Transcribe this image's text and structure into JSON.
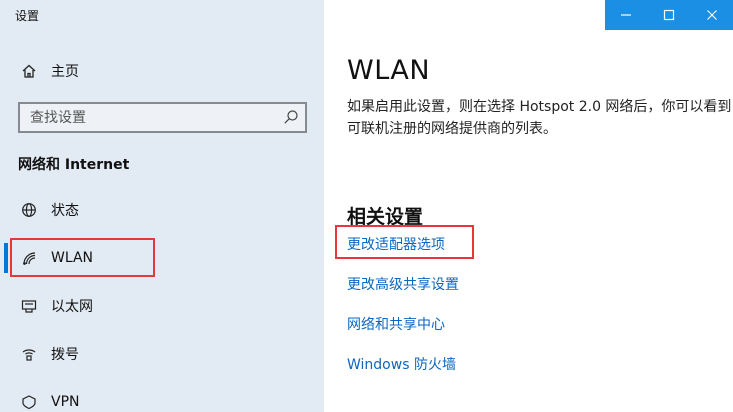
{
  "window": {
    "title": "设置",
    "controls": [
      "minimize-icon",
      "maximize-icon",
      "close-icon"
    ],
    "accent_color": "#1a8fe3"
  },
  "sidebar": {
    "home_label": "主页",
    "search_placeholder": "查找设置",
    "section_header": "网络和 Internet",
    "items": [
      {
        "label": "状态",
        "icon": "globe-icon"
      },
      {
        "label": "WLAN",
        "icon": "wifi-icon",
        "selected": true
      },
      {
        "label": "以太网",
        "icon": "ethernet-icon"
      },
      {
        "label": "拨号",
        "icon": "dialup-icon"
      },
      {
        "label": "VPN",
        "icon": "vpn-icon"
      }
    ]
  },
  "main": {
    "title": "WLAN",
    "description": "如果启用此设置，则在选择 Hotspot 2.0 网络后，你可以看到可联机注册的网络提供商的列表。",
    "related_title": "相关设置",
    "links": [
      "更改适配器选项",
      "更改高级共享设置",
      "网络和共享中心",
      "Windows 防火墙"
    ],
    "link_color": "#0b67c2",
    "highlight_color": "#e5383b"
  }
}
